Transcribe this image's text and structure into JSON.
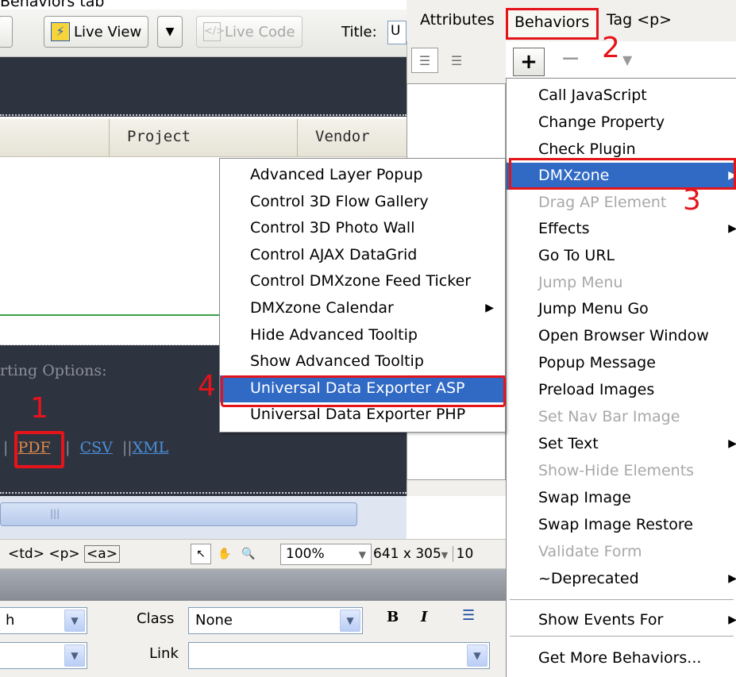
{
  "caption": "Behaviors tab",
  "toolbar": {
    "live_view": "Live View",
    "live_code": "Live Code",
    "title_label": "Title:",
    "title_value": "U"
  },
  "table_headers": [
    "Project",
    "Vendor"
  ],
  "export": {
    "label": "rting Options:",
    "sep1": "|",
    "pdf": "PDF",
    "sep2": "||",
    "csv": "CSV",
    "sep3": "||",
    "xml": "XML"
  },
  "status_bar": {
    "tags": [
      "<td>",
      "<p>",
      "<a>"
    ],
    "zoom": "100%",
    "size": "641 x 305",
    "size_extra": "10"
  },
  "properties": {
    "format_value": "h",
    "class_label": "Class",
    "class_value": "None",
    "link_label": "Link",
    "bold": "B",
    "italic": "I"
  },
  "panel": {
    "tab_attributes": "Attributes",
    "tab_behaviors": "Behaviors",
    "tab_tag": "Tag <p>",
    "plus": "+",
    "minus": "−"
  },
  "behaviors_menu": [
    {
      "label": "Call JavaScript",
      "disabled": false
    },
    {
      "label": "Change Property",
      "disabled": false
    },
    {
      "label": "Check Plugin",
      "disabled": false
    },
    {
      "label": "DMXzone",
      "disabled": false,
      "submenu": true,
      "highlighted": true
    },
    {
      "label": "Drag AP Element",
      "disabled": true
    },
    {
      "label": "Effects",
      "disabled": false,
      "submenu": true
    },
    {
      "label": "Go To URL",
      "disabled": false
    },
    {
      "label": "Jump Menu",
      "disabled": true
    },
    {
      "label": "Jump Menu Go",
      "disabled": false
    },
    {
      "label": "Open Browser Window",
      "disabled": false
    },
    {
      "label": "Popup Message",
      "disabled": false
    },
    {
      "label": "Preload Images",
      "disabled": false
    },
    {
      "label": "Set Nav Bar Image",
      "disabled": true
    },
    {
      "label": "Set Text",
      "disabled": false,
      "submenu": true
    },
    {
      "label": "Show-Hide Elements",
      "disabled": true
    },
    {
      "label": "Swap Image",
      "disabled": false
    },
    {
      "label": "Swap Image Restore",
      "disabled": false
    },
    {
      "label": "Validate Form",
      "disabled": true
    },
    {
      "label": "~Deprecated",
      "disabled": false,
      "submenu": true
    },
    {
      "label": "Show Events For",
      "disabled": false,
      "submenu": true
    },
    {
      "label": "Get More Behaviors...",
      "disabled": false
    }
  ],
  "dmxzone_submenu": [
    {
      "label": "Advanced Layer Popup"
    },
    {
      "label": "Control 3D Flow Gallery"
    },
    {
      "label": "Control 3D Photo Wall"
    },
    {
      "label": "Control AJAX DataGrid"
    },
    {
      "label": "Control DMXzone Feed Ticker"
    },
    {
      "label": "DMXzone Calendar",
      "submenu": true
    },
    {
      "label": "Hide Advanced Tooltip"
    },
    {
      "label": "Show Advanced Tooltip"
    },
    {
      "label": "Universal Data Exporter ASP",
      "highlighted": true
    },
    {
      "label": "Universal Data Exporter PHP"
    }
  ],
  "step_numbers": {
    "one": "1",
    "two": "2",
    "three": "3",
    "four": "4"
  },
  "colors": {
    "annotation_red": "#e5141b",
    "menu_highlight": "#316ac5",
    "dark_canvas": "#2e3340"
  },
  "icons": {
    "submenu_arrow": "triangle-right-icon",
    "dropdown": "chevron-down-icon"
  }
}
